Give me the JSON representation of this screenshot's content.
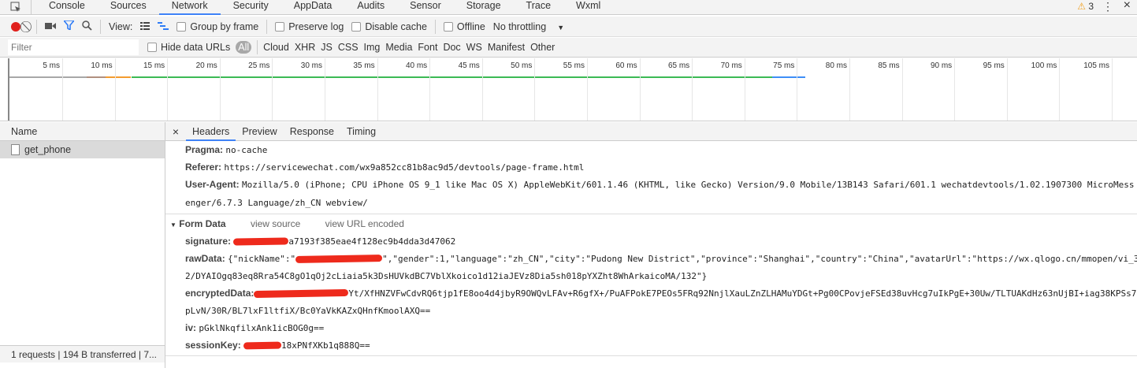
{
  "tabs": [
    "Console",
    "Sources",
    "Network",
    "Security",
    "AppData",
    "Audits",
    "Sensor",
    "Storage",
    "Trace",
    "Wxml"
  ],
  "active_tab": "Network",
  "warnings_count": "3",
  "toolbar": {
    "view_label": "View:",
    "group_by_frame": "Group by frame",
    "preserve_log": "Preserve log",
    "disable_cache": "Disable cache",
    "offline": "Offline",
    "throttling": "No throttling"
  },
  "filter": {
    "placeholder": "Filter",
    "hide_data_urls": "Hide data URLs",
    "types": [
      "All",
      "Cloud",
      "XHR",
      "JS",
      "CSS",
      "Img",
      "Media",
      "Font",
      "Doc",
      "WS",
      "Manifest",
      "Other"
    ]
  },
  "timeline": {
    "ticks": [
      "5 ms",
      "10 ms",
      "15 ms",
      "20 ms",
      "25 ms",
      "30 ms",
      "35 ms",
      "40 ms",
      "45 ms",
      "50 ms",
      "55 ms",
      "60 ms",
      "65 ms",
      "70 ms",
      "75 ms",
      "80 ms",
      "85 ms",
      "90 ms",
      "95 ms",
      "100 ms",
      "105 ms"
    ]
  },
  "requests": {
    "header": "Name",
    "items": [
      "get_phone"
    ],
    "status": "1 requests | 194 B transferred | 7..."
  },
  "details": {
    "tabs": [
      "Headers",
      "Preview",
      "Response",
      "Timing"
    ],
    "headers": [
      {
        "key": "Pragma:",
        "value": "no-cache"
      },
      {
        "key": "Referer:",
        "value": "https://servicewechat.com/wx9a852cc81b8ac9d5/devtools/page-frame.html"
      },
      {
        "key": "User-Agent:",
        "value": "Mozilla/5.0 (iPhone; CPU iPhone OS 9_1 like Mac OS X) AppleWebKit/601.1.46 (KHTML, like Gecko) Version/9.0 Mobile/13B143 Safari/601.1 wechatdevtools/1.02.1907300 MicroMessenger/6.7.3 Language/zh_CN webview/"
      }
    ],
    "form_data": {
      "title": "Form Data",
      "view_source": "view source",
      "view_url_encoded": "view URL encoded",
      "signature": {
        "key": "signature:",
        "value": "a7193f385eae4f128ec9b4dda3d47062"
      },
      "rawData": {
        "key": "rawData:",
        "value_a": "{\"nickName\":\"",
        "value_b": "\",\"gender\":1,\"language\":\"zh_CN\",\"city\":\"Pudong New District\",\"province\":\"Shanghai\",\"country\":\"China\",\"avatarUrl\":\"https://wx.qlogo.cn/mmopen/vi_3",
        "line2": "2/DYAIOgq83eq8Rra54C8gO1qOj2cLiaia5k3DsHUVkdBC7VblXkoico1d12iaJEVz8Dia5sh018pYXZht8WhArkaicoMA/132\"}"
      },
      "encryptedData": {
        "key": "encryptedData:",
        "value": "Yt/XfHNZVFwCdvRQ6tjp1fE8oo4d4jbyR9OWQvLFAv+R6gfX+/PuAFPokE7PEOs5FRq92NnjlXauLZnZLHAMuYDGt+Pg00CPovjeFSEd38uvHcg7uIkPgE+30Uw/TLTUAKdHz63nUjBI+iag38KPSs7",
        "line2": "pLvN/30R/BL7lxF1ltfiX/Bc0YaVkKAZxQHnfKmoolAXQ=="
      },
      "iv": {
        "key": "iv:",
        "value": "pGklNkqfilxAnk1icBOG0g=="
      },
      "sessionKey": {
        "key": "sessionKey:",
        "value": "18xPNfXKb1q888Q=="
      }
    }
  }
}
